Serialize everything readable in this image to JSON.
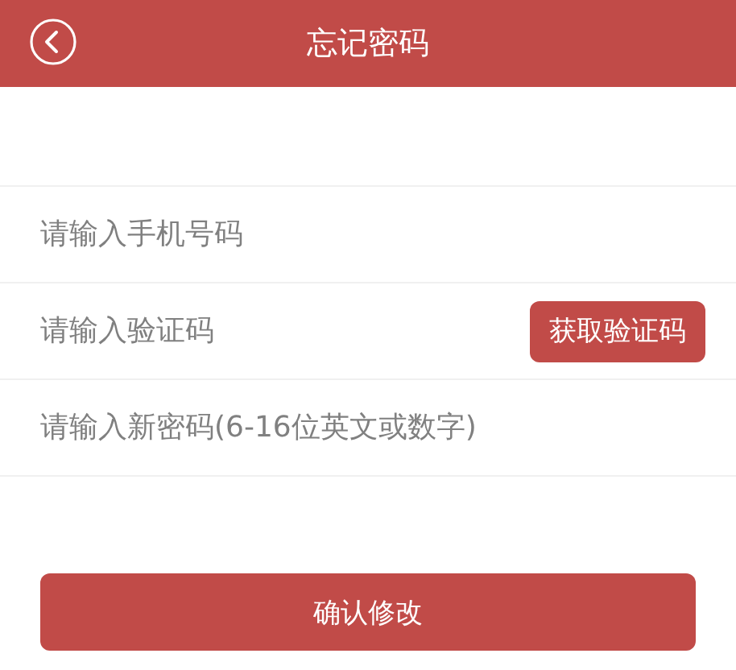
{
  "header": {
    "title": "忘记密码"
  },
  "fields": [
    {
      "placeholder": "请输入手机号码"
    },
    {
      "placeholder": "请输入验证码",
      "button": "获取验证码"
    },
    {
      "placeholder": "请输入新密码(6-16位英文或数字)"
    }
  ],
  "submit": "确认修改"
}
